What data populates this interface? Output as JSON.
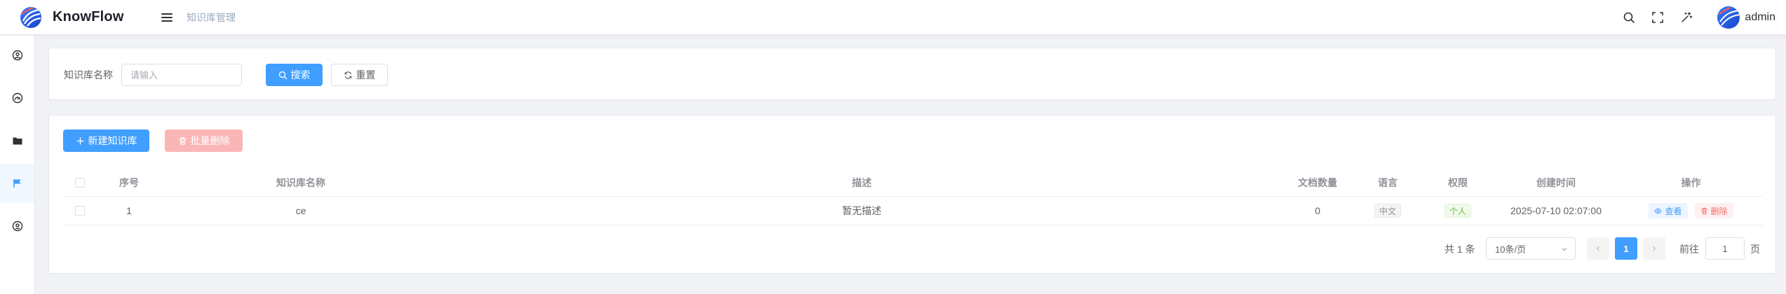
{
  "app": {
    "name": "KnowFlow"
  },
  "header": {
    "breadcrumb": "知识库管理",
    "user_name": "admin",
    "icons": [
      "search-icon",
      "fullscreen-icon",
      "theme-icon"
    ]
  },
  "sidebar": {
    "items": [
      {
        "icon": "user-circle-icon",
        "active": false
      },
      {
        "icon": "gauge-icon",
        "active": false
      },
      {
        "icon": "folder-icon",
        "active": false
      },
      {
        "icon": "flag-icon",
        "active": true
      },
      {
        "icon": "profile-icon",
        "active": false
      }
    ]
  },
  "search": {
    "name_label": "知识库名称",
    "name_placeholder": "请输入",
    "name_value": "",
    "search_label": "搜索",
    "reset_label": "重置"
  },
  "toolbar": {
    "create_label": "新建知识库",
    "batch_delete_label": "批量删除"
  },
  "table": {
    "columns": [
      "序号",
      "知识库名称",
      "描述",
      "文档数量",
      "语言",
      "权限",
      "创建时间",
      "操作"
    ],
    "rows": [
      {
        "index": "1",
        "name": "ce",
        "description": "暂无描述",
        "doc_count": "0",
        "language": "中文",
        "permission": "个人",
        "created_at": "2025-07-10 02:07:00",
        "actions": {
          "view": "查看",
          "delete": "删除"
        }
      }
    ]
  },
  "pagination": {
    "total_text": "共 1 条",
    "page_size": "10条/页",
    "current_page": "1",
    "goto_prefix": "前往",
    "goto_value": "1",
    "goto_suffix": "页"
  },
  "colors": {
    "primary": "#409eff",
    "danger": "#f56c6c",
    "danger_disabled": "#fab6b6",
    "success": "#67c23a"
  }
}
